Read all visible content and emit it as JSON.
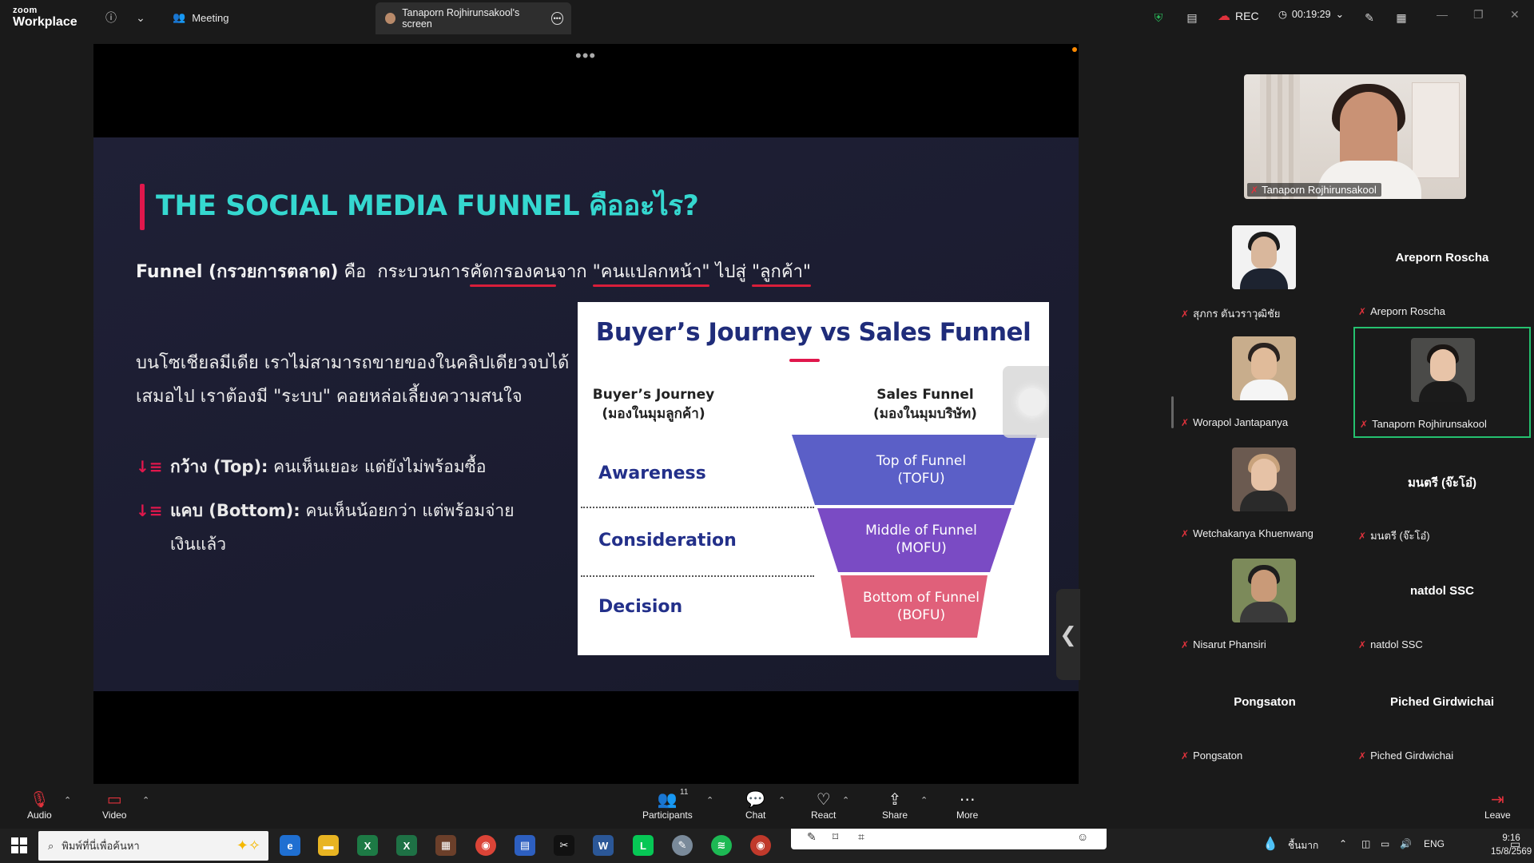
{
  "app": {
    "brand_top": "zoom",
    "brand_bottom": "Workplace"
  },
  "topbar": {
    "meeting_label": "Meeting",
    "screen_tab_label": "Tanaporn Rojhirunsakool's screen",
    "rec_label": "REC",
    "timer": "00:19:29"
  },
  "slide": {
    "title": "THE SOCIAL MEDIA FUNNEL คืออะไร?",
    "def_bold": "Funnel (กรวยการตลาด)",
    "def_is": "คือ",
    "def_pre": "กระบวนการ",
    "def_u1": "คัดกรองคน",
    "def_mid": "จาก",
    "def_u2": "\"คนแปลกหน้า\"",
    "def_to": "ไปสู่",
    "def_u3": "\"ลูกค้า\"",
    "para": "บนโซเชียลมีเดีย เราไม่สามารถขายของในคลิปเดียวจบได้เสมอไป เราต้องมี \"ระบบ\" คอยหล่อเลี้ยงความสนใจ",
    "bullet1_bold": "กว้าง (Top):",
    "bullet1_text": "คนเห็นเยอะ แต่ยังไม่พร้อมซื้อ",
    "bullet2_bold": "แคบ (Bottom):",
    "bullet2_text": "คนเห็นน้อยกว่า แต่พร้อมจ่ายเงินแล้ว"
  },
  "funnel_card": {
    "title": "Buyer’s Journey vs Sales Funnel",
    "col_left_1": "Buyer’s Journey",
    "col_left_2": "(มองในมุมลูกค้า)",
    "col_right_1": "Sales Funnel",
    "col_right_2": "(มองในมุมบริษัท)",
    "stages": [
      "Awareness",
      "Consideration",
      "Decision"
    ],
    "segments": [
      {
        "line1": "Top of Funnel",
        "line2": "(TOFU)",
        "color": "#5b5fc7"
      },
      {
        "line1": "Middle of Funnel",
        "line2": "(MOFU)",
        "color": "#7a4bc4"
      },
      {
        "line1": "Bottom of Funnel",
        "line2": "(BOFU)",
        "color": "#e0607a"
      }
    ]
  },
  "gallery": {
    "speaker_name": "Tanaporn Rojhirunsakool",
    "tiles": [
      {
        "big": "",
        "tag": "สุภกร ตันวราวุฒิชัย",
        "photo": true,
        "skin": "#d9b79c",
        "hair": "#1c1c1c",
        "top": "#1d2330",
        "bg": "#f2f2f2"
      },
      {
        "big": "Areporn  Roscha",
        "tag": "Areporn  Roscha",
        "photo": false
      },
      {
        "big": "",
        "tag": "Worapol Jantapanya",
        "photo": true,
        "skin": "#e0bb9a",
        "hair": "#2a2320",
        "top": "#f5f5f5",
        "bg": "#c8ad8c"
      },
      {
        "big": "",
        "tag": "Tanaporn Rojhirunsakool",
        "photo": true,
        "skin": "#e8c4a8",
        "hair": "#1a1614",
        "top": "#1b1b1b",
        "bg": "#4a4a48"
      },
      {
        "big": "",
        "tag": "Wetchakanya Khuenwang",
        "photo": true,
        "skin": "#e6c2a6",
        "hair": "#c8a27c",
        "top": "#2a2a2a",
        "bg": "#6b5a50"
      },
      {
        "big": "มนตรี (จ๊ะโอ๋)",
        "tag": "มนตรี (จ๊ะโอ๋)",
        "photo": false
      },
      {
        "big": "",
        "tag": "Nisarut Phansiri",
        "photo": true,
        "skin": "#c99a78",
        "hair": "#1e1e1e",
        "top": "#3a3a3a",
        "bg": "#7c8a5a"
      },
      {
        "big": "natdol SSC",
        "tag": "natdol SSC",
        "photo": false
      },
      {
        "big": "Pongsaton",
        "tag": "Pongsaton",
        "photo": false
      },
      {
        "big": "Piched Girdwichai",
        "tag": "Piched Girdwichai",
        "photo": false
      }
    ]
  },
  "toolbar": {
    "audio": "Audio",
    "video": "Video",
    "participants": "Participants",
    "participants_count": "11",
    "chat": "Chat",
    "react": "React",
    "share": "Share",
    "more": "More",
    "leave": "Leave"
  },
  "taskbar": {
    "search_placeholder": "พิมพ์ที่นี่เพื่อค้นหา",
    "weather": "ชื้นมาก",
    "lang": "ENG",
    "time": "9:16",
    "date": "15/8/2569"
  },
  "colors": {
    "accent_red": "#e0174c",
    "title_cyan": "#35d8d0",
    "active_green": "#25c16f",
    "rec_red": "#e0323c"
  }
}
